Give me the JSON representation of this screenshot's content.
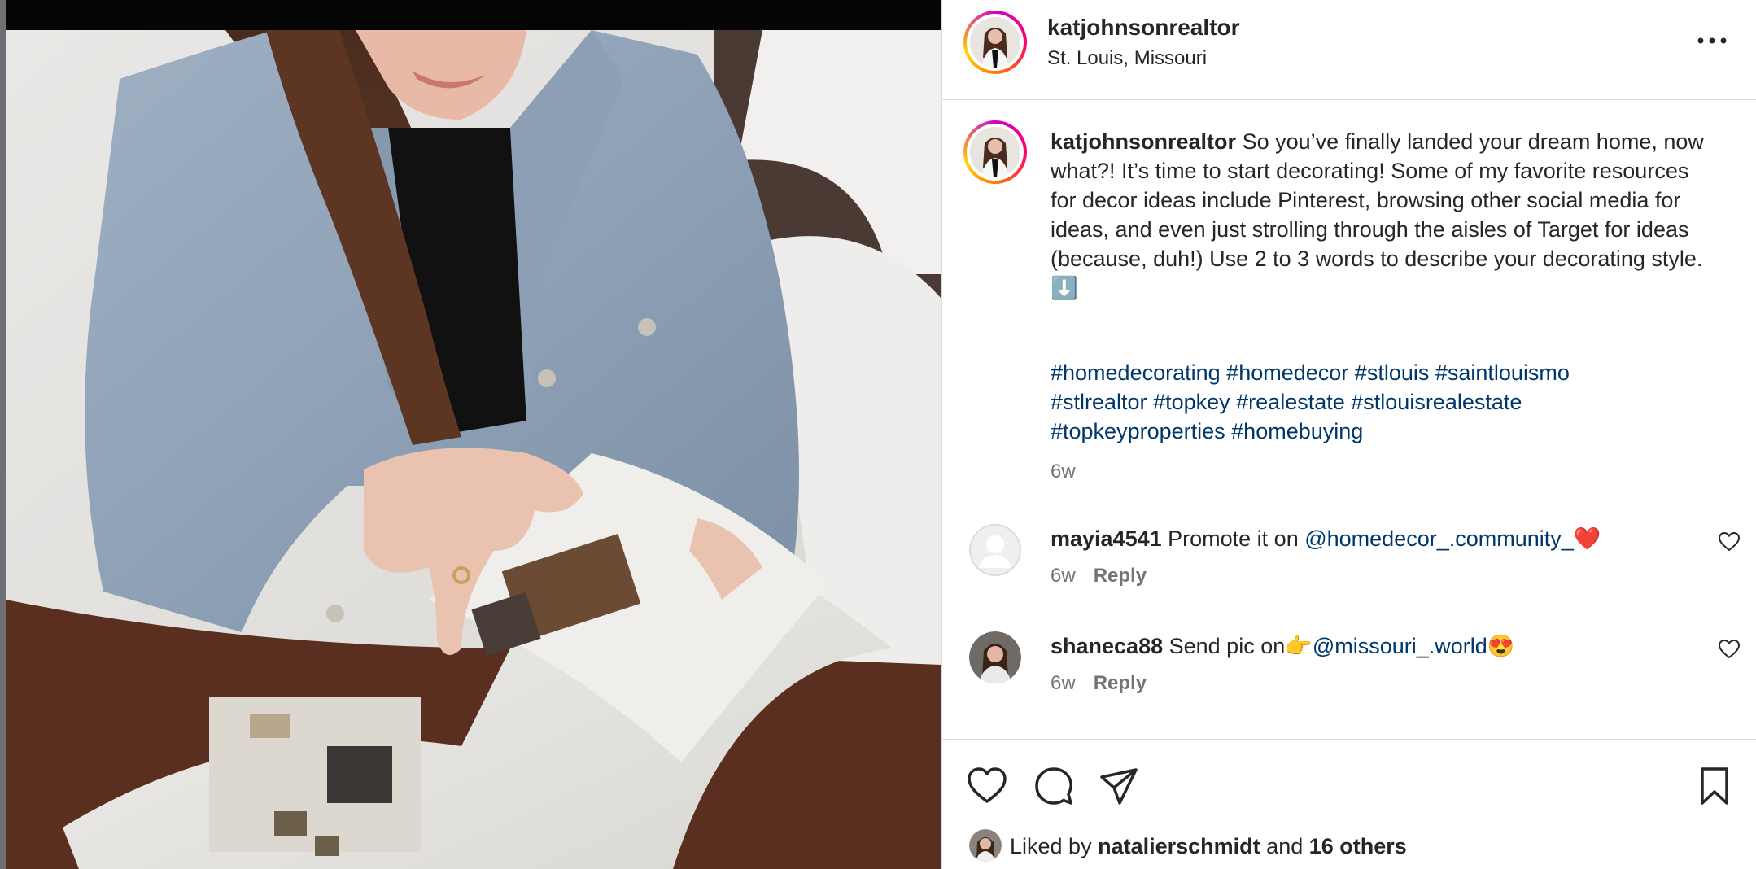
{
  "post": {
    "author": "katjohnsonrealtor",
    "location": "St. Louis, Missouri",
    "caption_username": "katjohnsonrealtor",
    "caption": "So you’ve finally landed your dream home, now what?! It’s time to start decorating! Some of my favorite resources for decor ideas include Pinterest, browsing other social media for ideas, and even just strolling through the aisles of Target for ideas (because, duh!) Use 2 to 3 words to describe your decorating style. ⬇️",
    "hashtags": [
      "#homedecorating",
      "#homedecor",
      "#stlouis",
      "#saintlouismo",
      "#stlrealtor",
      "#topkey",
      "#realestate",
      "#stlouisrealestate",
      "#topkeyproperties",
      "#homebuying"
    ],
    "time": "6w"
  },
  "comments": [
    {
      "username": "mayia4541",
      "text": "Promote it on",
      "mention": "@homedecor_.community_",
      "emoji": "❤️",
      "time": "6w",
      "reply": "Reply",
      "avatar": "default-avatar-icon"
    },
    {
      "username": "shaneca88",
      "text": "Send pic on👉",
      "mention": "@missouri_.world",
      "emoji": "😍",
      "time": "6w",
      "reply": "Reply",
      "avatar": "user-photo"
    }
  ],
  "likes": {
    "prefix": "Liked by",
    "user": "natalierschmidt",
    "middle": "and",
    "others": "16 others"
  },
  "icons": {
    "more": "more-options-icon",
    "like": "heart-icon",
    "comment": "comment-bubble-icon",
    "share": "paper-plane-icon",
    "save": "bookmark-icon"
  },
  "colors": {
    "link": "#00376b",
    "secondary_text": "#737373",
    "divider": "#dbdbdb",
    "text": "#262626"
  }
}
